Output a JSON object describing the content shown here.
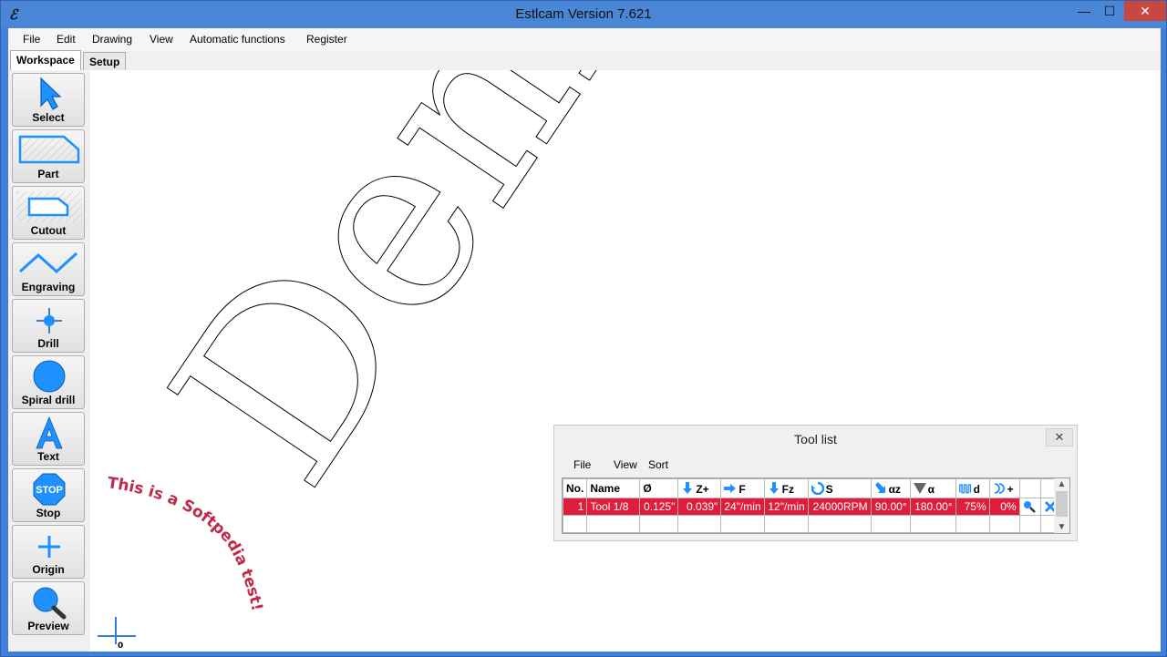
{
  "window": {
    "title": "Estlcam Version 7.621",
    "minimize": "—",
    "maximize": "☐",
    "close": "✕"
  },
  "menu": [
    "File",
    "Edit",
    "Drawing",
    "View",
    "Automatic functions",
    "Register"
  ],
  "tabs": [
    "Workspace",
    "Setup"
  ],
  "toolbar": [
    {
      "label": "Select",
      "icon": "select-arrow-icon"
    },
    {
      "label": "Part",
      "icon": "part-icon"
    },
    {
      "label": "Cutout",
      "icon": "cutout-icon"
    },
    {
      "label": "Engraving",
      "icon": "engraving-icon"
    },
    {
      "label": "Drill",
      "icon": "drill-icon"
    },
    {
      "label": "Spiral drill",
      "icon": "spiral-drill-icon"
    },
    {
      "label": "Text",
      "icon": "text-icon"
    },
    {
      "label": "Stop",
      "icon": "stop-icon"
    },
    {
      "label": "Origin",
      "icon": "origin-icon"
    },
    {
      "label": "Preview",
      "icon": "preview-magnifier-icon"
    }
  ],
  "stop_sign_text": "STOP",
  "canvas": {
    "demo_text": "Demo",
    "curved_text": "This is a Softpedia test!",
    "origin_label": "0"
  },
  "tool_list": {
    "title": "Tool list",
    "close": "✕",
    "menu": [
      "File",
      "View",
      "Sort"
    ],
    "headers": [
      "No.",
      "Name",
      "Ø",
      "Z+",
      "F",
      "Fz",
      "S",
      "αz",
      "α",
      "d",
      "+"
    ],
    "rows": [
      {
        "no": "1",
        "name": "Tool 1/8",
        "diameter": "0.125\"",
        "zplus": "0.039\"",
        "f": "24\"/min",
        "fz": "12\"/min",
        "s": "24000RPM",
        "az": "90.00°",
        "a": "180.00°",
        "d": "75%",
        "plus": "0%"
      }
    ]
  },
  "colors": {
    "accent_blue": "#1e90ff",
    "title_bar": "#4a86d6",
    "selected_row": "#e01e3c",
    "curved_text": "#c0294a"
  }
}
